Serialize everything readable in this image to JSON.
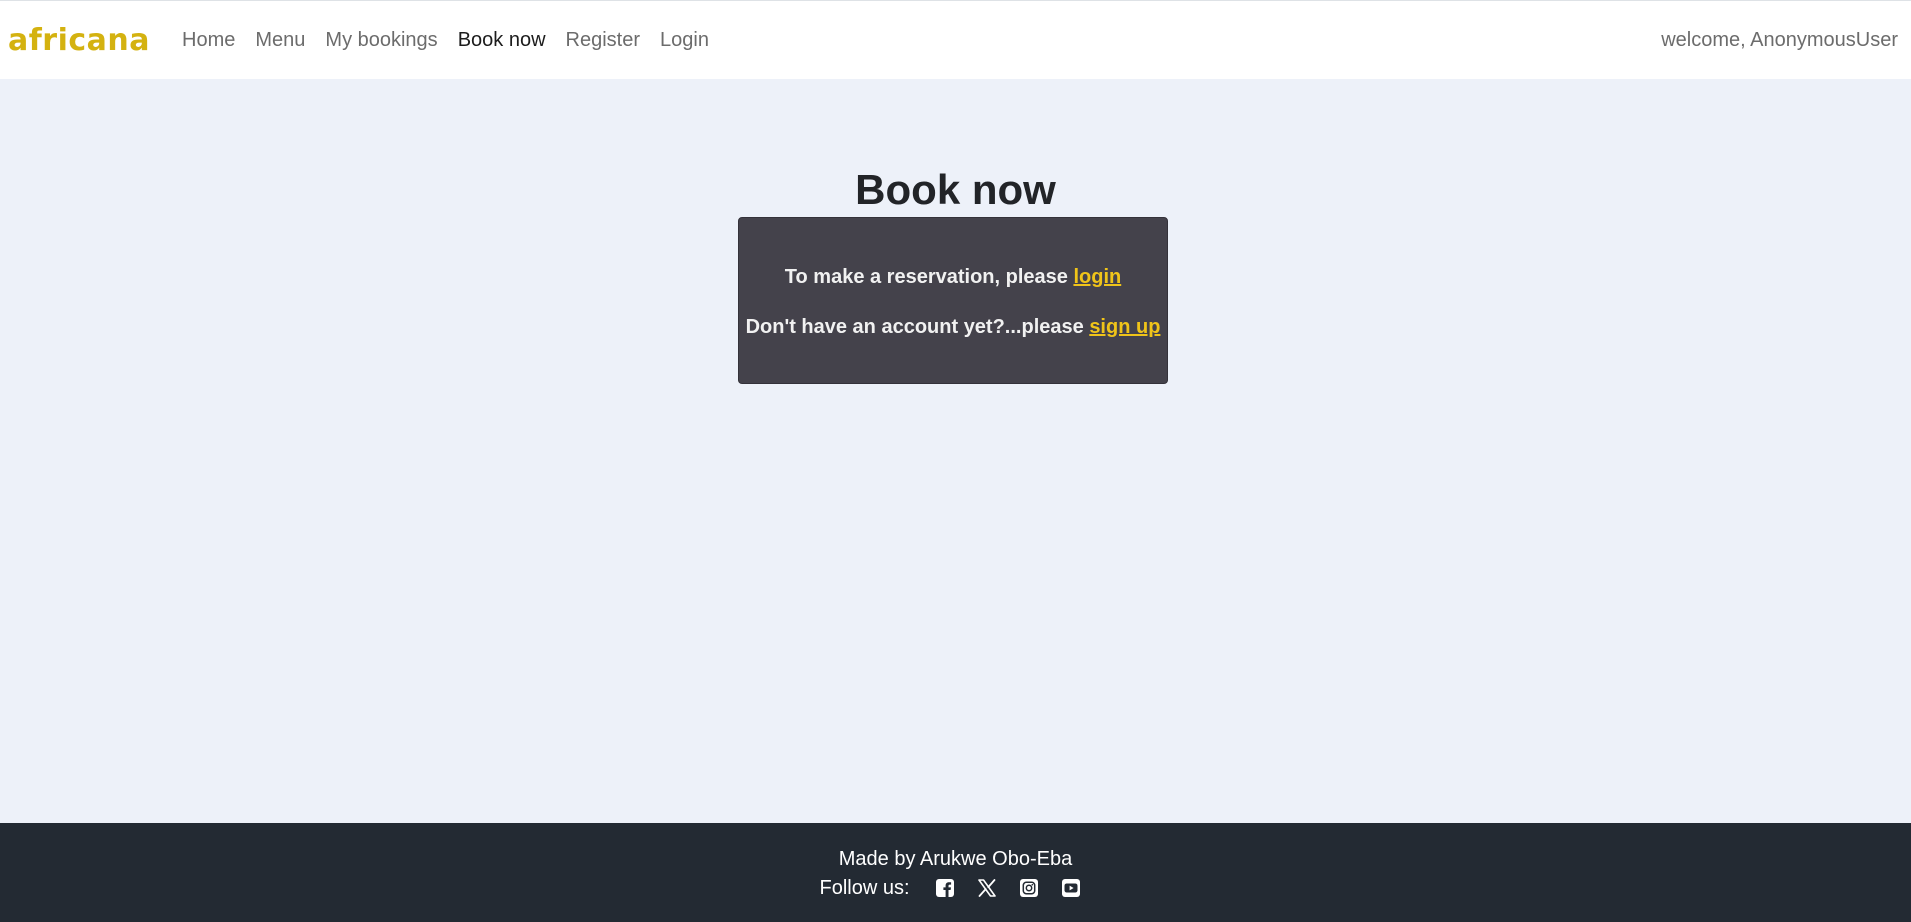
{
  "nav": {
    "brand": "africana",
    "links": [
      {
        "label": "Home"
      },
      {
        "label": "Menu"
      },
      {
        "label": "My bookings"
      },
      {
        "label": "Book now"
      },
      {
        "label": "Register"
      },
      {
        "label": "Login"
      }
    ],
    "welcome": "welcome, AnonymousUser"
  },
  "main": {
    "title": "Book now",
    "notice": {
      "line1_text": "To make a reservation, please ",
      "line1_link": "login",
      "line2_text": "Don't have an account yet?...please ",
      "line2_link": "sign up"
    }
  },
  "footer": {
    "credit": "Made by Arukwe Obo-Eba",
    "follow_label": "Follow us:",
    "social_icons": [
      "facebook-icon",
      "x-icon",
      "instagram-icon",
      "youtube-icon"
    ]
  },
  "colors": {
    "brand": "#d4b210",
    "link_accent": "#f0c419",
    "page_bg": "#edf1f9",
    "card_bg": "#44424b",
    "footer_bg": "#232a33"
  }
}
